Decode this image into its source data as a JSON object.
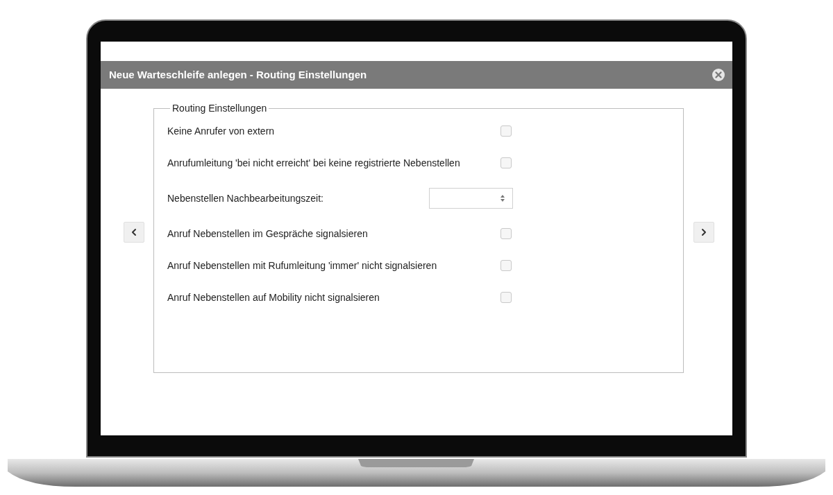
{
  "dialog": {
    "title": "Neue Warteschleife anlegen - Routing Einstellungen",
    "group": {
      "legend": "Routing Einstellungen",
      "rows": [
        {
          "kind": "checkbox",
          "label": "Keine Anrufer von extern",
          "checked": false
        },
        {
          "kind": "checkbox",
          "label": "Anrufumleitung 'bei nicht erreicht' bei keine registrierte Nebenstellen",
          "checked": false
        },
        {
          "kind": "number",
          "label": "Nebenstellen Nachbearbeitungszeit:"
        },
        {
          "kind": "checkbox",
          "label": "Anruf Nebenstellen im Gespräche signalsieren",
          "checked": false
        },
        {
          "kind": "checkbox",
          "label": "Anruf Nebenstellen mit Rufumleitung 'immer' nicht signalsieren",
          "checked": false
        },
        {
          "kind": "checkbox",
          "label": "Anruf Nebenstellen auf Mobility nicht signalsieren",
          "checked": false
        }
      ]
    }
  }
}
